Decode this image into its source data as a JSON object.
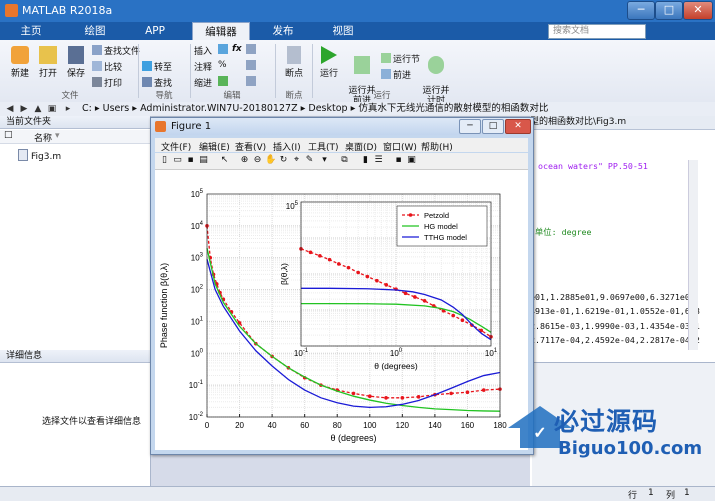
{
  "window": {
    "title": "MATLAB R2018a",
    "minimize": "─",
    "maximize": "□",
    "close": "✕"
  },
  "tabs": [
    {
      "label": "主页"
    },
    {
      "label": "绘图"
    },
    {
      "label": "APP"
    },
    {
      "label": "编辑器"
    },
    {
      "label": "发布"
    },
    {
      "label": "视图"
    }
  ],
  "search": {
    "placeholder": "搜索文档"
  },
  "ribbon": {
    "new": "新建",
    "open": "打开",
    "save": "保存",
    "find_files": "查找文件",
    "compare": "比较",
    "print": "打印",
    "go_to": "转至",
    "find": "查找",
    "insert": "插入",
    "comment": "注释",
    "indent": "缩进",
    "fx": "fx",
    "breakpoints": "断点",
    "run": "运行",
    "run_advance": "运行并\n前进",
    "run_section": "运行节",
    "advance": "前进",
    "run_time": "运行并\n计时",
    "groups": {
      "file": "文件",
      "nav": "导航",
      "edit": "编辑",
      "bp": "断点",
      "run": "运行"
    }
  },
  "address": {
    "segments": [
      "C:",
      "Users",
      "Administrator.WIN7U-20180127Z",
      "Desktop",
      "仿真水下无线光通信的散射模型的相函数对比"
    ]
  },
  "left_panel": {
    "header": "当前文件夹",
    "col_name": "名称",
    "file": "Fig3.m",
    "detail_header": "详细信息",
    "detail_msg": "选择文件以查看详细信息"
  },
  "editor": {
    "tab": "型的相函数对比\\Fig3.m",
    "lines": [
      "ocean waters\" PP.50-51",
      ",单位: degree",
      "e01,1.2885e01,9.0697e00,6.3271e0",
      "4913e-01,1.6219e-01,1.0552e-01,6.8",
      "2.8615e-03,1.9990e-03,1.4354e-03,1",
      "2.7117e-04,2.4592e-04,2.2817e-04,2"
    ]
  },
  "status": {
    "row_label": "行",
    "row": "1",
    "col_label": "列",
    "col": "1"
  },
  "figure": {
    "title": "Figure 1",
    "menu": [
      "文件(F)",
      "编辑(E)",
      "查看(V)",
      "插入(I)",
      "工具(T)",
      "桌面(D)",
      "窗口(W)",
      "帮助(H)"
    ]
  },
  "watermark": {
    "cn": "必过源码",
    "en": "Biguo100.com"
  },
  "chart_data": [
    {
      "type": "line",
      "xlabel": "θ (degrees)",
      "ylabel": "Phase function β(θ,λ)",
      "xlim": [
        0,
        180
      ],
      "ylim": [
        0.01,
        100000
      ],
      "yscale": "log",
      "xticks": [
        0,
        20,
        40,
        60,
        80,
        100,
        120,
        140,
        160,
        180
      ],
      "yticks": [
        "10^-2",
        "10^-1",
        "10^0",
        "10^1",
        "10^2",
        "10^3",
        "10^4",
        "10^5"
      ],
      "grid": true,
      "series": [
        {
          "name": "Petzold",
          "color": "#e8141b",
          "x": [
            0,
            2,
            4,
            6,
            8,
            10,
            15,
            20,
            30,
            40,
            50,
            60,
            70,
            80,
            90,
            100,
            110,
            120,
            130,
            140,
            150,
            160,
            170,
            180
          ],
          "y": [
            10000,
            1000,
            300,
            150,
            80,
            50,
            20,
            9,
            2,
            0.8,
            0.35,
            0.17,
            0.1,
            0.07,
            0.055,
            0.045,
            0.04,
            0.04,
            0.043,
            0.05,
            0.055,
            0.06,
            0.07,
            0.075
          ]
        },
        {
          "name": "HG model",
          "color": "#22c322",
          "x": [
            0,
            5,
            10,
            20,
            30,
            40,
            50,
            60,
            70,
            80,
            90,
            100,
            110,
            120,
            130,
            140,
            150,
            160,
            170,
            180
          ],
          "y": [
            2000,
            150,
            40,
            7,
            2,
            0.8,
            0.35,
            0.18,
            0.1,
            0.065,
            0.045,
            0.034,
            0.027,
            0.023,
            0.02,
            0.018,
            0.017,
            0.016,
            0.0155,
            0.0152
          ]
        },
        {
          "name": "TTHG model",
          "color": "#1a1ad6",
          "x": [
            0,
            5,
            10,
            20,
            30,
            40,
            50,
            60,
            70,
            80,
            90,
            100,
            110,
            120,
            130,
            140,
            150,
            160,
            170,
            180
          ],
          "y": [
            900,
            100,
            30,
            5,
            1.2,
            0.4,
            0.15,
            0.07,
            0.04,
            0.028,
            0.022,
            0.02,
            0.021,
            0.025,
            0.033,
            0.05,
            0.08,
            0.13,
            0.2,
            0.25
          ]
        }
      ]
    },
    {
      "type": "line",
      "xlabel": "θ (degrees)",
      "ylabel": "β(θ,λ)",
      "xscale": "log",
      "yscale": "log",
      "xlim": [
        0.1,
        10
      ],
      "ylim": [
        10,
        100000
      ],
      "grid": true,
      "legend": "top-right",
      "series": [
        {
          "name": "Petzold",
          "color": "#e8141b",
          "x": [
            0.1,
            0.126,
            0.158,
            0.2,
            0.25,
            0.316,
            0.4,
            0.5,
            0.63,
            0.79,
            1,
            1.26,
            1.58,
            2,
            2.5,
            3.16,
            4,
            5,
            6.3,
            7.9,
            10
          ],
          "y": [
            5000,
            4000,
            3200,
            2500,
            1900,
            1500,
            1100,
            850,
            650,
            500,
            380,
            290,
            230,
            180,
            130,
            95,
            70,
            52,
            38,
            27,
            18
          ]
        },
        {
          "name": "HG model",
          "color": "#22c322",
          "x": [
            0.1,
            0.2,
            0.5,
            1,
            2,
            3,
            4,
            5,
            6,
            7,
            8,
            10
          ],
          "y": [
            150,
            150,
            149,
            145,
            130,
            110,
            90,
            70,
            55,
            43,
            35,
            24
          ]
        },
        {
          "name": "TTHG model",
          "color": "#1a1ad6",
          "x": [
            0.1,
            0.2,
            0.5,
            1,
            1.5,
            2,
            3,
            4,
            5,
            6,
            7,
            8,
            10
          ],
          "y": [
            400,
            400,
            390,
            360,
            320,
            270,
            190,
            120,
            75,
            45,
            30,
            22,
            15
          ]
        }
      ]
    }
  ]
}
